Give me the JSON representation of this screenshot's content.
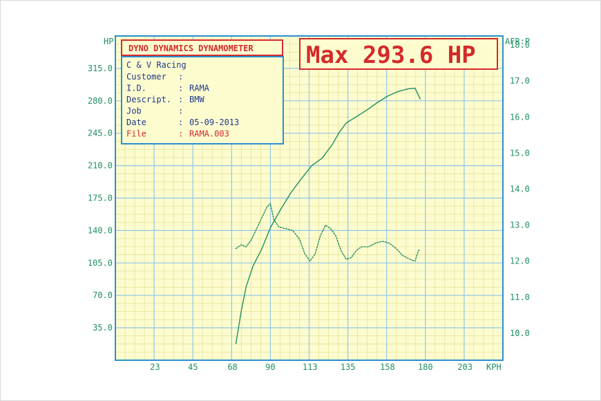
{
  "header": {
    "title": "DYNO DYNAMICS DYNAMOMETER",
    "max_reading": "Max 293.6 HP"
  },
  "info": {
    "shop": "C & V Racing",
    "rows": [
      {
        "label": "Customer",
        "sep": ":",
        "value": ""
      },
      {
        "label": "I.D.",
        "sep": ":",
        "value": "RAMA"
      },
      {
        "label": "Descript.",
        "sep": ":",
        "value": "BMW"
      },
      {
        "label": "Job",
        "sep": ":",
        "value": ""
      },
      {
        "label": "Date",
        "sep": ":",
        "value": "05-09-2013"
      },
      {
        "label": "File",
        "sep": ":",
        "value": "RAMA.003"
      }
    ]
  },
  "colors": {
    "grid_bg": "#fdfccf",
    "grid_minor": "#e6e29a",
    "grid_major": "#8fc6e6",
    "border": "#2a8fce",
    "curve": "#1f8f5f",
    "red": "#d42a2a",
    "navy": "#1e3a8a",
    "axis_text": "#1f8f5f"
  },
  "chart_data": {
    "type": "line",
    "left_unit": "HP",
    "right_unit": "AFR:P",
    "x_unit": "KPH",
    "x_ticks": [
      "23",
      "45",
      "68",
      "90",
      "113",
      "135",
      "158",
      "180",
      "203"
    ],
    "y_left_ticks": [
      "35.0",
      "70.0",
      "105.0",
      "140.0",
      "175.0",
      "210.0",
      "245.0",
      "280.0",
      "315.0"
    ],
    "y_right_ticks": [
      "10.0",
      "11.0",
      "12.0",
      "13.0",
      "14.0",
      "15.0",
      "16.0",
      "17.0",
      "18.0"
    ],
    "xlim": [
      0,
      225
    ],
    "ylim_left": [
      0,
      350
    ],
    "ylim_right": [
      9.25,
      18.25
    ],
    "grid": true,
    "series": [
      {
        "axis": "left",
        "style": "solid",
        "x": [
          70,
          73,
          76,
          80,
          85,
          90,
          96,
          102,
          108,
          114,
          120,
          126,
          130,
          134,
          140,
          146,
          152,
          158,
          164,
          170,
          174,
          177
        ],
        "y": [
          18,
          52,
          80,
          102,
          120,
          143,
          163,
          181,
          196,
          210,
          218,
          233,
          246,
          256,
          263,
          270,
          278,
          285,
          290,
          293,
          293.6,
          282
        ]
      },
      {
        "axis": "right",
        "style": "dotted",
        "x": [
          70,
          73,
          76,
          79,
          82,
          85,
          88,
          90,
          92,
          95,
          99,
          103,
          107,
          110,
          113,
          116,
          119,
          122,
          125,
          128,
          131,
          134,
          137,
          140,
          143,
          147,
          151,
          155,
          159,
          163,
          167,
          171,
          174,
          176,
          177
        ],
        "y": [
          12.35,
          12.45,
          12.4,
          12.6,
          12.9,
          13.2,
          13.5,
          13.6,
          13.15,
          12.95,
          12.9,
          12.85,
          12.6,
          12.2,
          12.0,
          12.2,
          12.7,
          13.0,
          12.9,
          12.7,
          12.3,
          12.05,
          12.1,
          12.3,
          12.4,
          12.4,
          12.5,
          12.55,
          12.5,
          12.35,
          12.15,
          12.05,
          12.0,
          12.3,
          12.3
        ]
      }
    ]
  }
}
